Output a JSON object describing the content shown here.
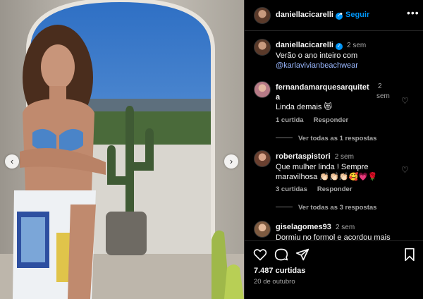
{
  "post": {
    "username": "daniellacicarelli",
    "follow_label": "Seguir",
    "likes_text": "7.487 curtidas",
    "date_text": "20 de outubro"
  },
  "caption": {
    "username": "daniellacicarelli",
    "time": "2 sem",
    "text": "Verão o ano inteiro com",
    "mention": "@karlavivianbeachwear"
  },
  "comments": [
    {
      "username": "fernandamarquesarquitet",
      "username_tail": "a",
      "time": "2",
      "time_tail": "sem",
      "text": "Linda demais 😻",
      "likes": "1 curtida",
      "reply_label": "Responder",
      "view_replies": "Ver todas as 1 respostas"
    },
    {
      "username": "robertaspistori",
      "time": "2 sem",
      "text": "Que mulher linda ! Sempre maravilhosa 👏🏻👏🏻👏🏻🥰💗🌹",
      "likes": "3 curtidas",
      "reply_label": "Responder",
      "view_replies": "Ver todas as 3 respostas"
    },
    {
      "username": "giselagomes93",
      "time": "2 sem",
      "text": "Dormiu no formol e acordou mais"
    }
  ],
  "icons": [
    "heart-icon",
    "comment-icon",
    "share-icon",
    "bookmark-icon",
    "more-options-icon",
    "verified-icon",
    "chevron-left-icon",
    "chevron-right-icon"
  ],
  "colors": {
    "accent": "#0095f6",
    "background": "#000000",
    "muted": "#a8a8a8"
  }
}
